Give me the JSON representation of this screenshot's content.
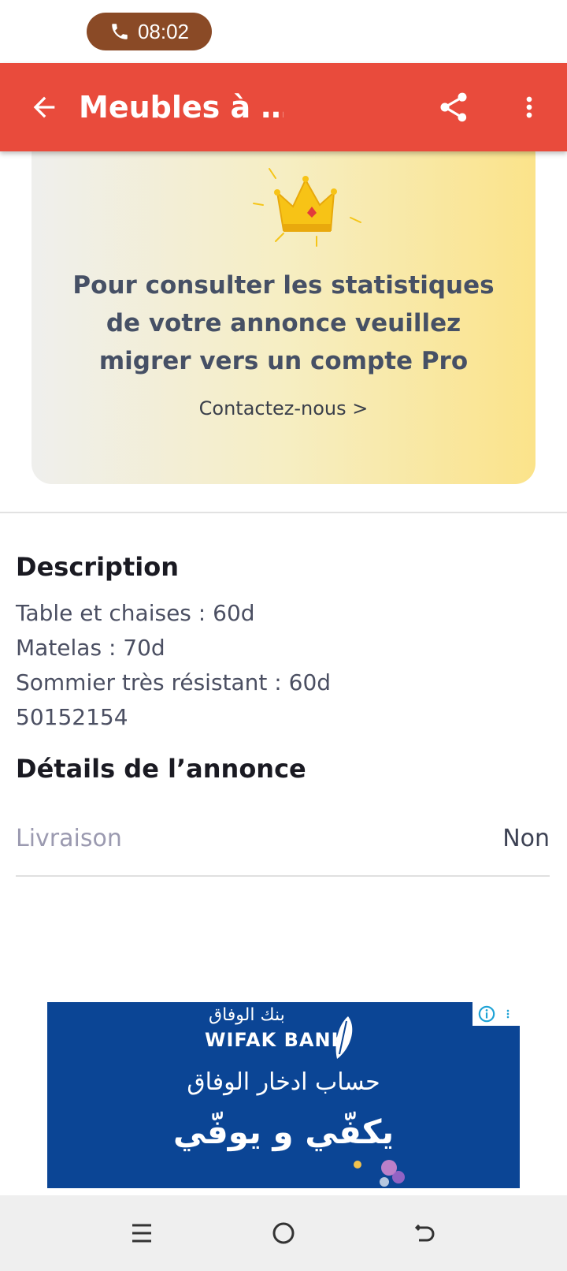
{
  "status_bar": {
    "call_time": "08:02"
  },
  "app_bar": {
    "title": "Meubles à …"
  },
  "promo": {
    "message": "Pour consulter les statistiques de votre annonce veuillez migrer vers un compte Pro",
    "link_label": "Contactez-nous >"
  },
  "description": {
    "title": "Description",
    "lines": [
      "Table et chaises : 60d",
      "Matelas : 70d",
      "Sommier très résistant : 60d",
      "50152154"
    ]
  },
  "details": {
    "title": "Détails de l’annonce",
    "rows": [
      {
        "label": "Livraison",
        "value": "Non"
      }
    ]
  },
  "ad": {
    "bank_name": "WIFAK BANK",
    "bank_name_ar": "بنك الوفاق",
    "line1": "حساب ادخار الوفاق",
    "line2": "يكفّي و يوفّي"
  },
  "colors": {
    "accent": "#e94b3c",
    "call_pill": "#8a4a26",
    "ad_bg": "#0b4595",
    "promo_text": "#465065"
  }
}
